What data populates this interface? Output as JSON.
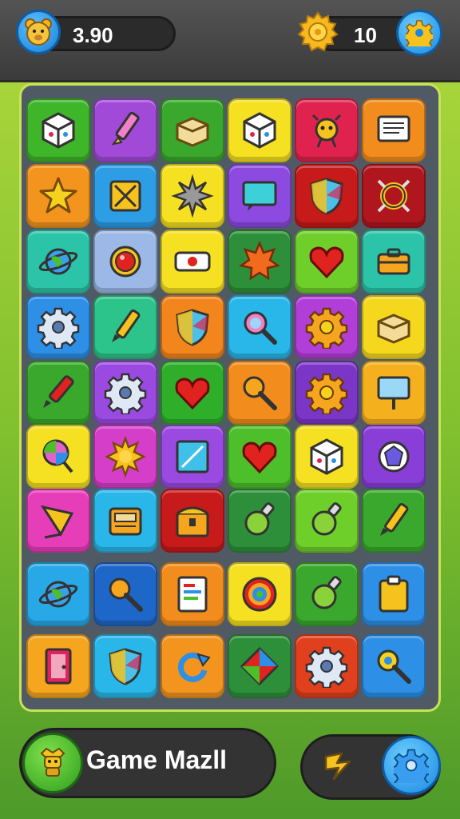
{
  "hud": {
    "score": "3.90",
    "coins": "10",
    "avatar_icon": "bear-avatar-icon",
    "coin_icon": "gold-coin-icon",
    "settings_icon": "gear-icon"
  },
  "board": {
    "rows": [
      [
        {
          "color": "#3fb52a",
          "icon": "cube-icon"
        },
        {
          "color": "#a14ad8",
          "icon": "pencil-icon"
        },
        {
          "color": "#3aa82c",
          "icon": "box-icon"
        },
        {
          "color": "#f5e021",
          "icon": "cube-icon"
        },
        {
          "color": "#e0234e",
          "icon": "bug-icon"
        },
        {
          "color": "#f28c1c",
          "icon": "note-icon"
        }
      ],
      [
        {
          "color": "#f2941e",
          "icon": "star-icon"
        },
        {
          "color": "#2d9de6",
          "icon": "crate-icon"
        },
        {
          "color": "#f5e021",
          "icon": "spiky-ball-icon"
        },
        {
          "color": "#8c4ae0",
          "icon": "monitor-icon"
        },
        {
          "color": "#c71a1a",
          "icon": "shield-icon"
        },
        {
          "color": "#b0161e",
          "icon": "ring-icon"
        }
      ],
      [
        {
          "color": "#2cc4a8",
          "icon": "planet-icon"
        },
        {
          "color": "#9bb8e6",
          "icon": "red-button-icon"
        },
        {
          "color": "#f5e021",
          "icon": "ticket-icon"
        },
        {
          "color": "#2e8f3a",
          "icon": "spiky-star-icon"
        },
        {
          "color": "#6fcf2a",
          "icon": "heart-icon"
        },
        {
          "color": "#2cc4a8",
          "icon": "toolbox-icon"
        }
      ],
      [
        {
          "color": "#2d8fe6",
          "icon": "gear-icon"
        },
        {
          "color": "#2cc48a",
          "icon": "crayon-icon"
        },
        {
          "color": "#f2861c",
          "icon": "shield-icon"
        },
        {
          "color": "#29b6e8",
          "icon": "magnifier-icon"
        },
        {
          "color": "#b23ed8",
          "icon": "sun-gear-icon"
        },
        {
          "color": "#f5d81e",
          "icon": "box-icon"
        }
      ],
      [
        {
          "color": "#3aa82c",
          "icon": "marker-icon"
        },
        {
          "color": "#9a4ae0",
          "icon": "gear-icon"
        },
        {
          "color": "#2fae2a",
          "icon": "heart-icon"
        },
        {
          "color": "#f28c1c",
          "icon": "mace-icon"
        },
        {
          "color": "#7b36c8",
          "icon": "sun-gear-icon"
        },
        {
          "color": "#f5b01e",
          "icon": "sign-icon"
        }
      ],
      [
        {
          "color": "#f5e021",
          "icon": "lollipop-icon"
        },
        {
          "color": "#d43ec8",
          "icon": "sun-icon"
        },
        {
          "color": "#9a4ae0",
          "icon": "frame-icon"
        },
        {
          "color": "#4cbf2a",
          "icon": "heart-icon"
        },
        {
          "color": "#f5e021",
          "icon": "cube-icon"
        },
        {
          "color": "#8a3ed8",
          "icon": "gem-icon"
        }
      ],
      [
        {
          "color": "#e63eb8",
          "icon": "kite-icon"
        },
        {
          "color": "#29b6e8",
          "icon": "radio-icon"
        },
        {
          "color": "#c71a1a",
          "icon": "chest-icon"
        },
        {
          "color": "#2e8f3a",
          "icon": "potion-icon"
        },
        {
          "color": "#6fcf2a",
          "icon": "potion-icon"
        },
        {
          "color": "#3aa82c",
          "icon": "crayon-icon"
        }
      ],
      [
        {
          "color": "#29a8e8",
          "icon": "planet-icon"
        },
        {
          "color": "#1e66c8",
          "icon": "mace-icon"
        },
        {
          "color": "#f28c1c",
          "icon": "document-icon"
        },
        {
          "color": "#f5e021",
          "icon": "swirl-icon"
        },
        {
          "color": "#3aa82c",
          "icon": "potion-icon"
        },
        {
          "color": "#2d8fe6",
          "icon": "clipboard-icon"
        }
      ],
      [
        {
          "color": "#f5a51e",
          "icon": "door-icon"
        },
        {
          "color": "#29b6e8",
          "icon": "shield-icon"
        },
        {
          "color": "#f2941e",
          "icon": "rotate-icon"
        },
        {
          "color": "#2e8f3a",
          "icon": "diamond-icon"
        },
        {
          "color": "#e0401e",
          "icon": "gear-icon"
        },
        {
          "color": "#2d8fe6",
          "icon": "key-icon"
        }
      ]
    ]
  },
  "footer": {
    "play_icon": "character-icon",
    "title": "Game Mazll",
    "tool_icon": "hammer-icon",
    "settings_icon": "gear-icon"
  }
}
